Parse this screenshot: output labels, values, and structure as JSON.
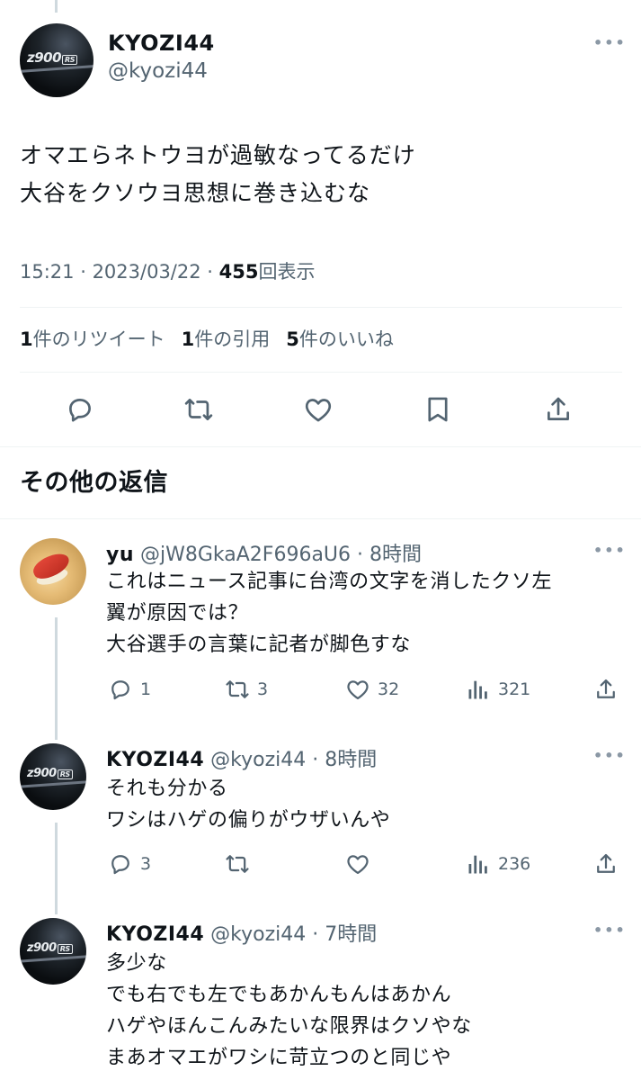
{
  "main_tweet": {
    "display_name": "KYOZI44",
    "handle": "@kyozi44",
    "avatar_logo": "z900",
    "avatar_logo_suffix": "RS",
    "text_lines": [
      "オマエらネトウヨが過敏なってるだけ",
      "大谷をクソウヨ思想に巻き込むな"
    ],
    "time": "15:21",
    "date": "2023/03/22",
    "views": "455",
    "views_label": "回表示",
    "retweets_count": "1",
    "retweets_label": "件のリツイート",
    "quotes_count": "1",
    "quotes_label": "件の引用",
    "likes_count": "5",
    "likes_label": "件のいいね"
  },
  "section_title": "その他の返信",
  "replies": [
    {
      "display_name": "yu",
      "handle": "@jW8GkaA2F696aU6",
      "time": "8時間",
      "text_lines": [
        "これはニュース記事に台湾の文字を消したクソ左",
        "翼が原因では？",
        "大谷選手の言葉に記者が脚色すな"
      ],
      "reply_count": "1",
      "retweet_count": "3",
      "like_count": "32",
      "view_count": "321"
    },
    {
      "display_name": "KYOZI44",
      "handle": "@kyozi44",
      "time": "8時間",
      "text_lines": [
        "それも分かる",
        "ワシはハゲの偏りがウザいんや"
      ],
      "reply_count": "3",
      "retweet_count": "",
      "like_count": "",
      "view_count": "236"
    },
    {
      "display_name": "KYOZI44",
      "handle": "@kyozi44",
      "time": "7時間",
      "text_lines": [
        "多少な",
        "でも右でも左でもあかんもんはあかん",
        "ハゲやほんこんみたいな限界はクソやな",
        "まあオマエがワシに苛立つのと同じや"
      ]
    }
  ],
  "icons": {
    "reply": "reply-icon",
    "retweet": "retweet-icon",
    "like": "like-icon",
    "bookmark": "bookmark-icon",
    "share": "share-icon",
    "views": "views-icon",
    "more": "more-icon"
  },
  "colors": {
    "text": "#0f1419",
    "secondary": "#536471",
    "divider": "#eff3f4",
    "thread_line": "#cfd9de"
  }
}
